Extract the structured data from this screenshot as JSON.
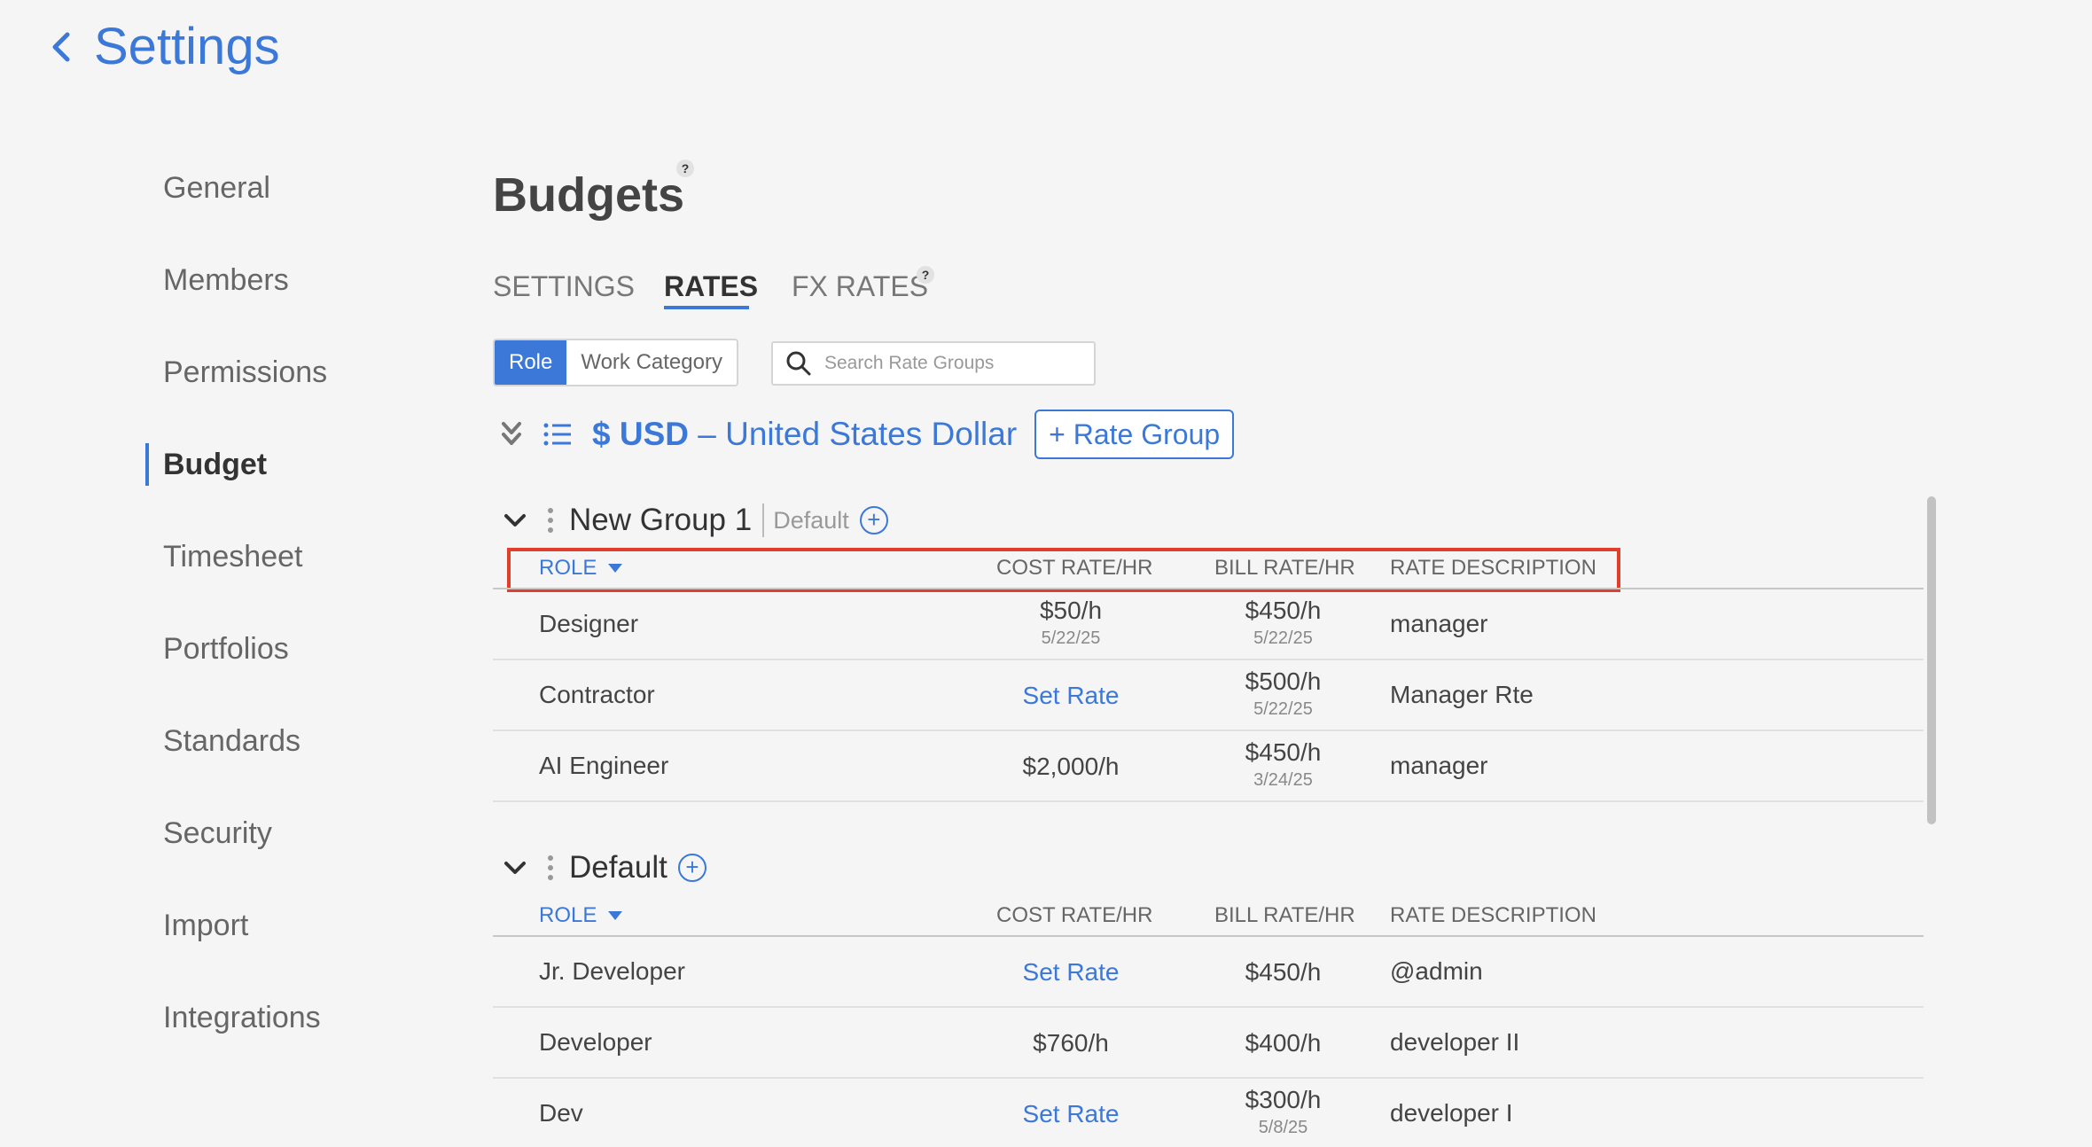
{
  "header": {
    "back_title": "Settings"
  },
  "sidebar": {
    "items": [
      {
        "label": "General"
      },
      {
        "label": "Members"
      },
      {
        "label": "Permissions"
      },
      {
        "label": "Budget"
      },
      {
        "label": "Timesheet"
      },
      {
        "label": "Portfolios"
      },
      {
        "label": "Standards"
      },
      {
        "label": "Security"
      },
      {
        "label": "Import"
      },
      {
        "label": "Integrations"
      }
    ],
    "active": "Budget"
  },
  "main": {
    "title": "Budgets",
    "help_mark": "?",
    "tabs": [
      {
        "label": "SETTINGS"
      },
      {
        "label": "RATES"
      },
      {
        "label": "FX RATES"
      }
    ],
    "active_tab": "RATES",
    "toggle": {
      "role": "Role",
      "work_category": "Work Category",
      "selected": "Role"
    },
    "search": {
      "placeholder": "Search Rate Groups"
    },
    "currency": {
      "symbol_code": "$ USD",
      "dash": "–",
      "name": "United States Dollar"
    },
    "add_rate_group": "+ Rate Group",
    "columns": {
      "role": "ROLE",
      "cost": "COST RATE/HR",
      "bill": "BILL RATE/HR",
      "desc": "RATE DESCRIPTION"
    },
    "groups": [
      {
        "name": "New Group 1",
        "default_label": "Default",
        "rows": [
          {
            "role": "Designer",
            "cost": "$50/h",
            "cost_date": "5/22/25",
            "bill": "$450/h",
            "bill_date": "5/22/25",
            "desc": "manager"
          },
          {
            "role": "Contractor",
            "cost": "Set Rate",
            "cost_date": "",
            "bill": "$500/h",
            "bill_date": "5/22/25",
            "desc": "Manager Rte"
          },
          {
            "role": "AI Engineer",
            "cost": "$2,000/h",
            "cost_date": "",
            "bill": "$450/h",
            "bill_date": "3/24/25",
            "desc": "manager"
          }
        ]
      },
      {
        "name": "Default",
        "rows": [
          {
            "role": "Jr. Developer",
            "cost": "Set Rate",
            "cost_date": "",
            "bill": "$450/h",
            "bill_date": "",
            "desc": "@admin"
          },
          {
            "role": "Developer",
            "cost": "$760/h",
            "cost_date": "",
            "bill": "$400/h",
            "bill_date": "",
            "desc": "developer II"
          },
          {
            "role": "Dev",
            "cost": "Set Rate",
            "cost_date": "",
            "bill": "$300/h",
            "bill_date": "5/8/25",
            "desc": "developer I"
          }
        ]
      }
    ]
  },
  "colors": {
    "accent": "#3b78d8",
    "highlight": "#e0402b",
    "background": "#f5f5f5"
  }
}
